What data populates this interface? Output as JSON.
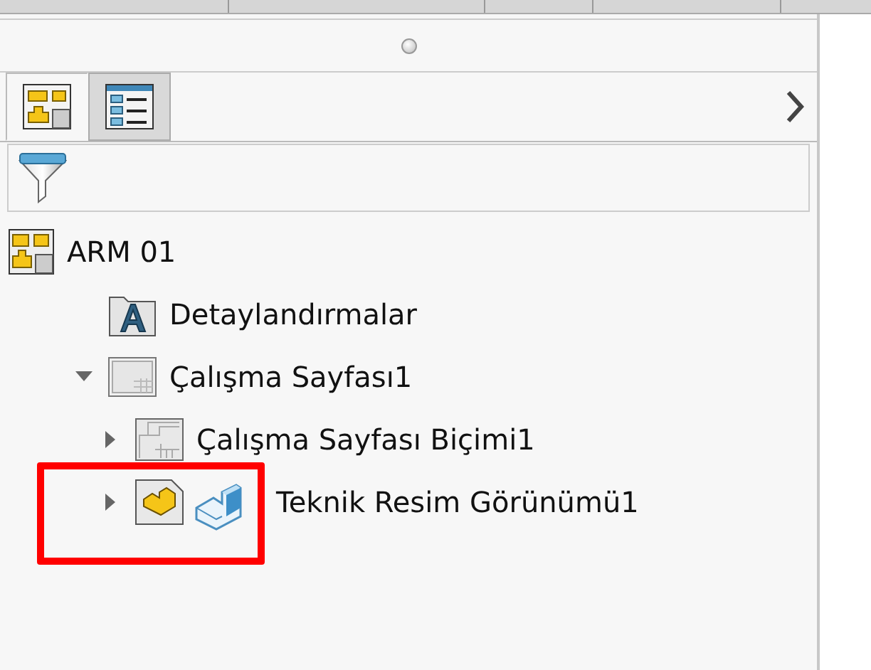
{
  "tabs": [
    {
      "kind": "tree",
      "selected": false
    },
    {
      "kind": "properties",
      "selected": true
    }
  ],
  "tree": [
    {
      "label": "ARM 01",
      "kind": "drawing",
      "children": [
        {
          "label": "Detaylandırmalar",
          "kind": "annotations"
        },
        {
          "label": "Çalışma Sayfası1",
          "kind": "sheet",
          "expanded": true,
          "children": [
            {
              "label": "Çalışma Sayfası Biçimi1",
              "kind": "sheet-format",
              "expanded": false
            },
            {
              "label": "Teknik Resim Görünümü1",
              "kind": "drawing-view",
              "expanded": false,
              "highlighted": true,
              "dragging": true
            }
          ]
        }
      ]
    }
  ]
}
